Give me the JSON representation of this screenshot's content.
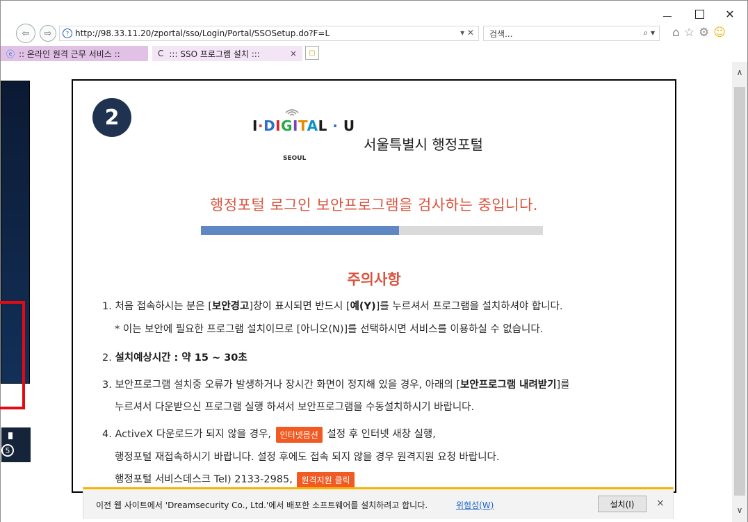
{
  "window": {
    "minimize": "–",
    "maximize": "",
    "close": "✕"
  },
  "address_bar": {
    "url": "http://98.33.11.20/zportal/sso/Login/Portal/SSOSetup.do?F=L",
    "tools": "▾ ✕"
  },
  "search": {
    "placeholder": "검색...",
    "tools": "⌕ ▾"
  },
  "toolbar": {
    "home": "⌂",
    "favorites": "☆",
    "settings": "⚙",
    "smiley": "☺"
  },
  "tabs": [
    {
      "label": ":: 온라인 원격 근무 서비스 ::",
      "icon": "ie-icon"
    },
    {
      "label": "::: SSO 프로그램 설치 :::",
      "icon": "loading-icon",
      "close": "×"
    }
  ],
  "side_shot": {
    "number": "5"
  },
  "page": {
    "step_number": "2",
    "logo_text": "I·DIGITAL·U",
    "logo_sub": "SEOUL",
    "portal_title": "서울특별시 행정포털",
    "headline": "행정포털 로그인 보안프로그램을 검사하는 중입니다.",
    "progress_fraction": 0.58,
    "notice_title": "주의사항",
    "item1a_pre": "1. 처음 접속하시는 분은 [",
    "item1a_bold1": "보안경고",
    "item1a_mid": "]창이 표시되면 반드시 [",
    "item1a_bold2": "예(Y)",
    "item1a_post": "]를 누르셔서 프로그램을 설치하셔야 합니다.",
    "item1b": "* 이는 보안에 필요한 프로그램 설치이므로 [아니오(N)]를 선택하시면 서비스를 이용하실 수 없습니다.",
    "item2_pre": "2. ",
    "item2_bold": "설치예상시간 : 약 15 ~ 30초",
    "item3a_pre": "3. 보안프로그램 설치중 오류가 발생하거나 장시간 화면이 정지해 있을 경우, 아래의 [",
    "item3a_bold": "보안프로그램 내려받기",
    "item3a_post": "]를",
    "item3b": "누르셔서 다운받으신 프로그램 실행 하셔서 보안프로그램을 수동설치하시기 바랍니다.",
    "item4a_pre": "4. ActiveX 다운로드가 되지 않을 경우,",
    "item4a_button": "인터넷옵션",
    "item4a_post": "설정 후 인터넷 새창 실행,",
    "item4b": "행정포털 재접속하시기 바랍니다. 설정 후에도 접속 되지 않을 경우 원격지원 요청 바랍니다.",
    "item4c_pre": "행정포털 서비스데스크 Tel) 2133-2985,",
    "item4c_button": "원격지원 클릭"
  },
  "notification": {
    "text": "이전 웹 사이트에서 'Dreamsecurity Co., Ltd.'에서 배포한 소프트웨어를 설치하려고 합니다.",
    "risk_link": "위험성(W)",
    "install_button": "설치(I)",
    "close": "×"
  },
  "scrollbar": {
    "up": "∧",
    "down": "∨"
  }
}
